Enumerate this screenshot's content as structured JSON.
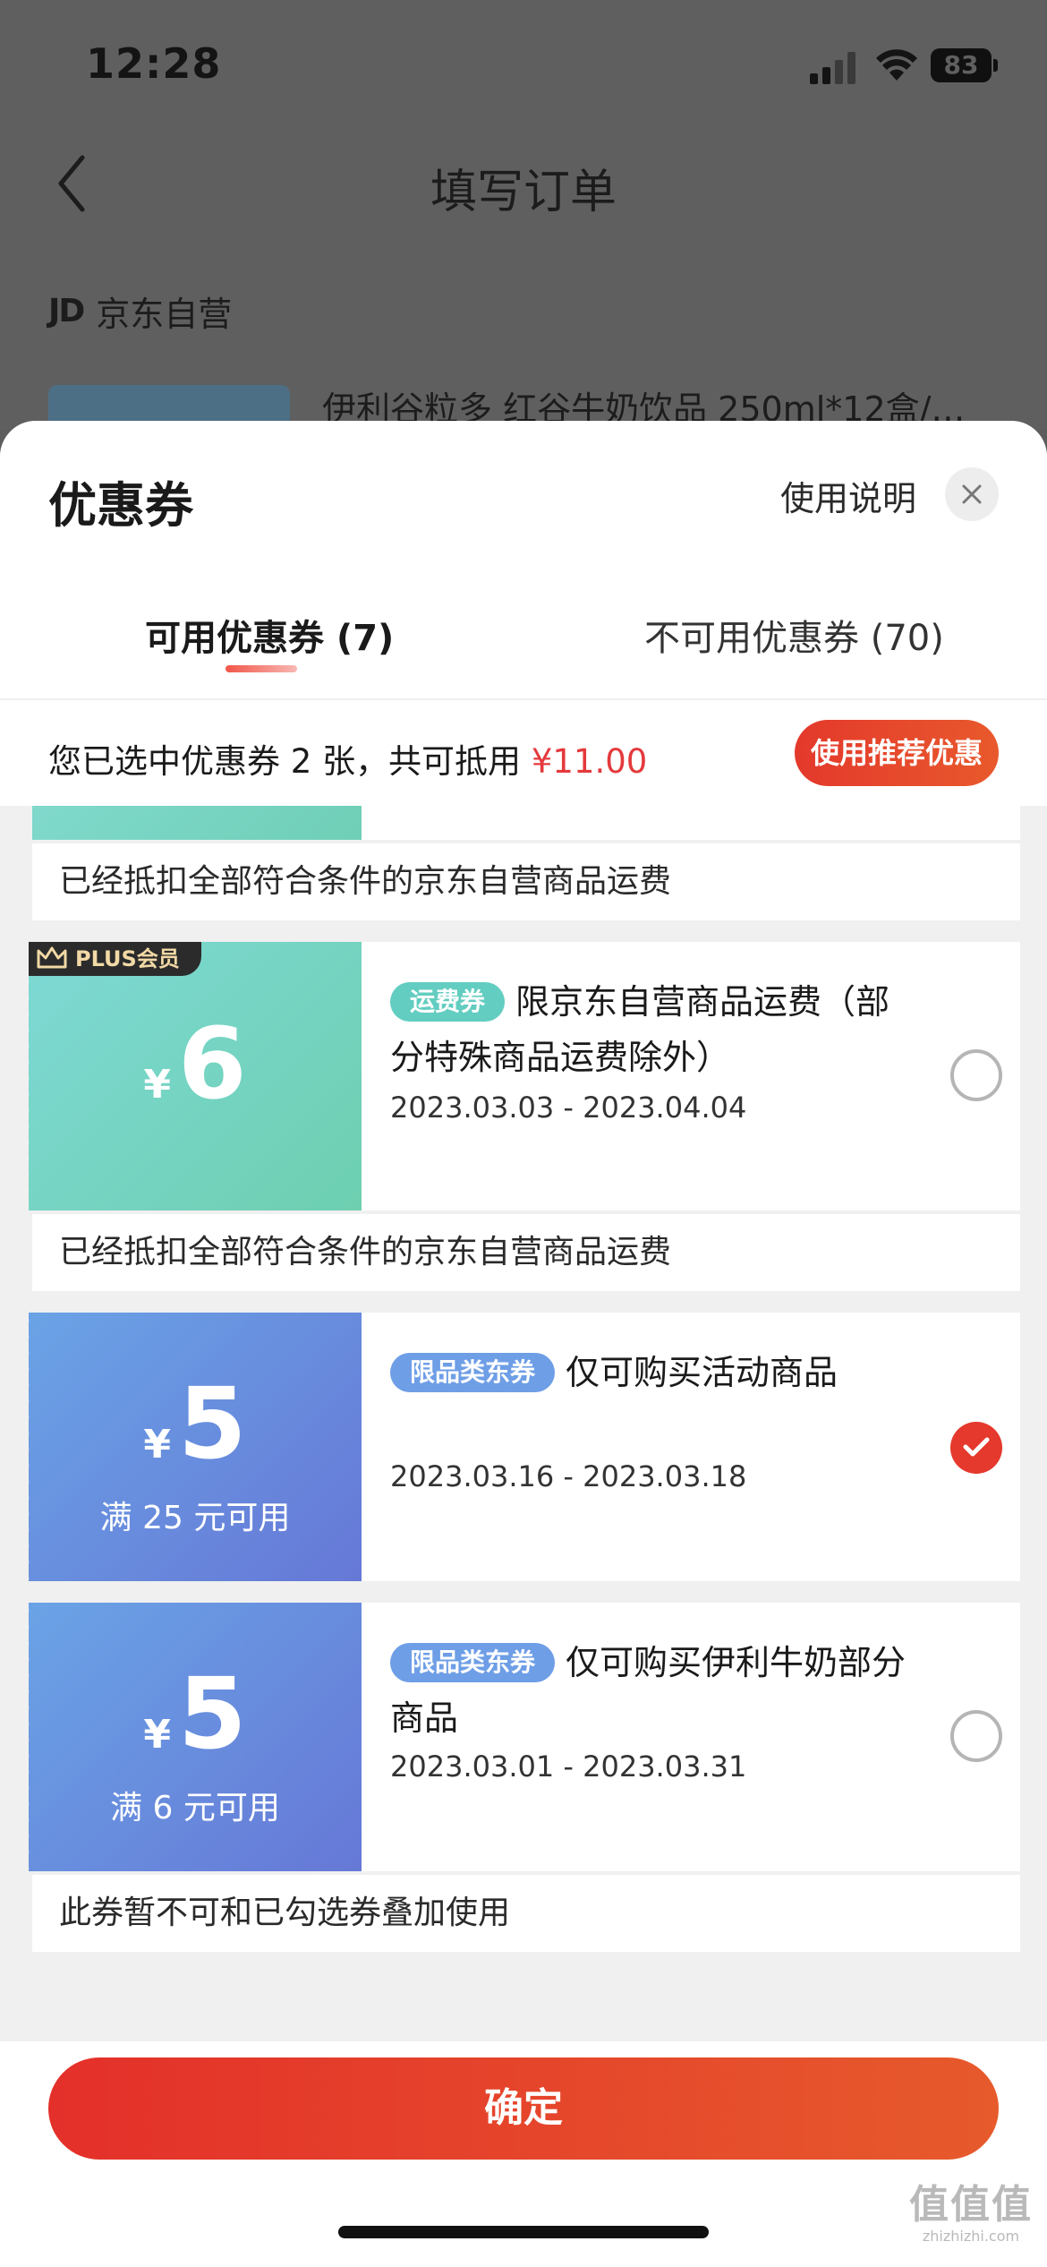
{
  "status_bar": {
    "time": "12:28",
    "battery": "83"
  },
  "background_page": {
    "title": "填写订单",
    "shop_logo": "JD",
    "shop_name": "京东自营",
    "product_name": "伊利谷粒多 红谷牛奶饮品 250ml*12盒/…"
  },
  "sheet": {
    "title": "优惠券",
    "help_label": "使用说明",
    "tabs": [
      {
        "label": "可用优惠券 (7)",
        "active": true
      },
      {
        "label": "不可用优惠券 (70)",
        "active": false
      }
    ],
    "summary": {
      "prefix": "您已选中优惠券 2 张，共可抵用 ",
      "amount": "¥11.00",
      "recommend_label": "使用推荐优惠"
    },
    "notes": {
      "top": "已经抵扣全部符合条件的京东自营商品运费",
      "shipping": "已经抵扣全部符合条件的京东自营商品运费",
      "exclusive": "此券暂不可和已勾选券叠加使用"
    },
    "coupons": [
      {
        "badge": "PLUS会员",
        "currency": "¥",
        "amount": "6",
        "threshold": "",
        "tag": "运费券",
        "desc": "限京东自营商品运费（部分特殊商品运费除外）",
        "date": "2023.03.03 - 2023.04.04",
        "checked": false,
        "color": "#6dcfb0"
      },
      {
        "currency": "¥",
        "amount": "5",
        "threshold": "满 25 元可用",
        "tag": "限品类东券",
        "desc": "仅可购买活动商品",
        "date": "2023.03.16 - 2023.03.18",
        "checked": true,
        "color": "#6678d6"
      },
      {
        "currency": "¥",
        "amount": "5",
        "threshold": "满 6 元可用",
        "tag": "限品类东券",
        "desc": "仅可购买伊利牛奶部分商品",
        "date": "2023.03.01 - 2023.03.31",
        "checked": false,
        "color": "#6678d6"
      }
    ],
    "confirm_label": "确定"
  },
  "watermark": {
    "main": "值值值",
    "sub": "zhizhizhi.com"
  },
  "colors": {
    "accent": "#e4392c",
    "price": "#e4393c"
  }
}
